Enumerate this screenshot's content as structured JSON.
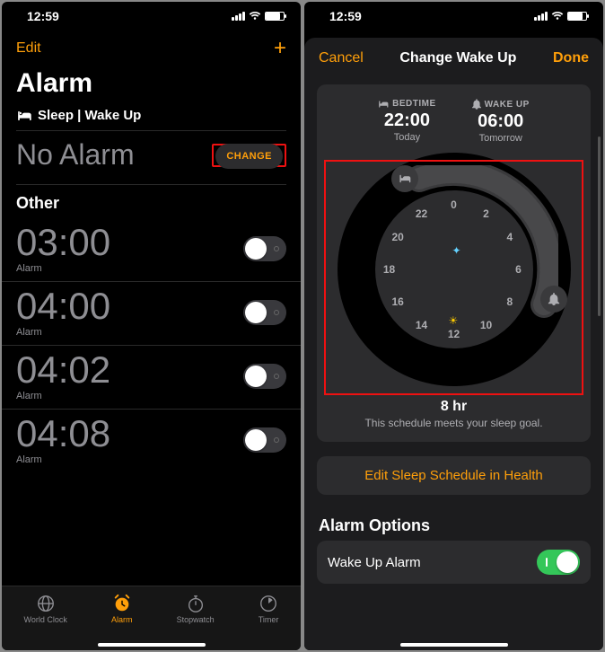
{
  "status": {
    "time": "12:59"
  },
  "left": {
    "edit": "Edit",
    "title": "Alarm",
    "sleep_label": "Sleep | Wake Up",
    "no_alarm": "No Alarm",
    "change": "CHANGE",
    "other": "Other",
    "alarms": [
      {
        "time": "03:00",
        "label": "Alarm"
      },
      {
        "time": "04:00",
        "label": "Alarm"
      },
      {
        "time": "04:02",
        "label": "Alarm"
      },
      {
        "time": "04:08",
        "label": "Alarm"
      }
    ],
    "tabs": {
      "world_clock": "World Clock",
      "alarm": "Alarm",
      "stopwatch": "Stopwatch",
      "timer": "Timer"
    }
  },
  "right": {
    "cancel": "Cancel",
    "title": "Change Wake Up",
    "done": "Done",
    "bedtime_lbl": "BEDTIME",
    "bedtime": "22:00",
    "bedtime_day": "Today",
    "wakeup_lbl": "WAKE UP",
    "wakeup": "06:00",
    "wakeup_day": "Tomorrow",
    "hours": [
      "0",
      "2",
      "4",
      "6",
      "8",
      "10",
      "12",
      "14",
      "16",
      "18",
      "20",
      "22"
    ],
    "duration": "8 hr",
    "duration_sub": "This schedule meets your sleep goal.",
    "edit_health": "Edit Sleep Schedule in Health",
    "alarm_options": "Alarm Options",
    "wakeup_alarm": "Wake Up Alarm"
  }
}
